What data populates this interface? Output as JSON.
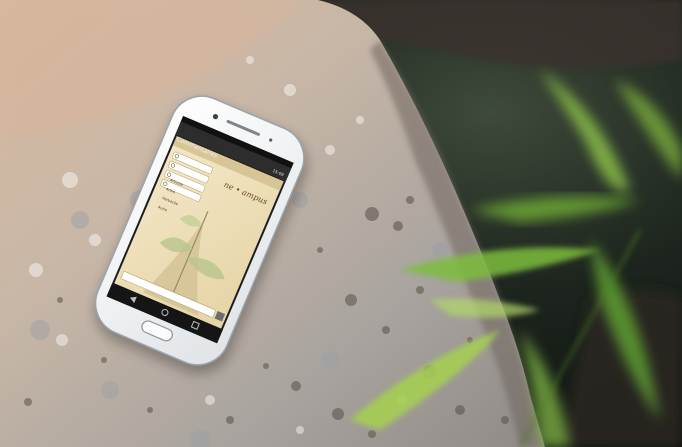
{
  "photo": {
    "subject": "Android smartphone lying on a speckled granite rock with blurred green leaves",
    "colors": {
      "rock": "#c9b8a6",
      "rock_shadow": "#8d7f71",
      "background_dark": "#1c231d",
      "leaf": "#7fbf3a",
      "phone_body": "#f4f6f7",
      "phone_screen_bar": "#2b2b2b",
      "app_background": "#efe3c2",
      "accent_brown": "#8a6a35"
    }
  },
  "phone": {
    "status_time": "15:09",
    "app_bar_title": "Commentaires",
    "app_brand": "ne • ampus",
    "options": [
      "Arbuste",
      "Arbre",
      "Herbacée",
      "Autre"
    ]
  }
}
